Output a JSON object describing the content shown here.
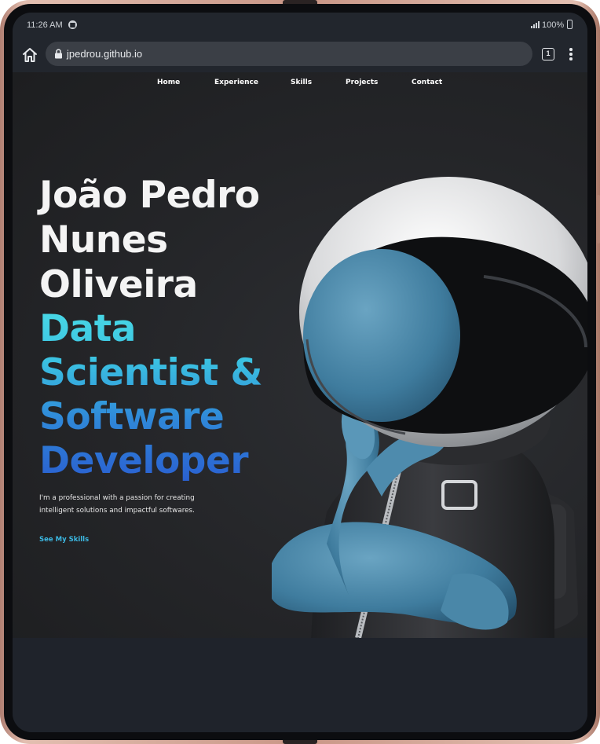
{
  "status_bar": {
    "time": "11:26 AM",
    "battery": "100%",
    "icons": [
      "spotify-icon",
      "signal-icon",
      "battery-icon"
    ]
  },
  "browser": {
    "url": "jpedrou.github.io",
    "tab_count": "1",
    "icons": [
      "home-icon",
      "lock-icon",
      "tabs-icon",
      "more-vert-icon"
    ]
  },
  "nav": {
    "items": [
      "Home",
      "Experience",
      "Skills",
      "Projects",
      "Contact"
    ]
  },
  "hero": {
    "name_lines": [
      "João Pedro",
      "Nunes",
      "Oliveira"
    ],
    "role_lines": [
      "Data",
      "Scientist &",
      "Software",
      "Developer"
    ],
    "description_lines": [
      "I'm a professional with a passion for creating",
      "intelligent solutions and impactful softwares."
    ],
    "cta": "See My Skills",
    "illustration": "astronaut-illustration"
  },
  "colors": {
    "site_background": "#242528",
    "gradient_start": "#49d9e6",
    "gradient_end": "#2a5fd0",
    "name_text": "#f4f4f4",
    "cta": "#3cb8e2"
  }
}
